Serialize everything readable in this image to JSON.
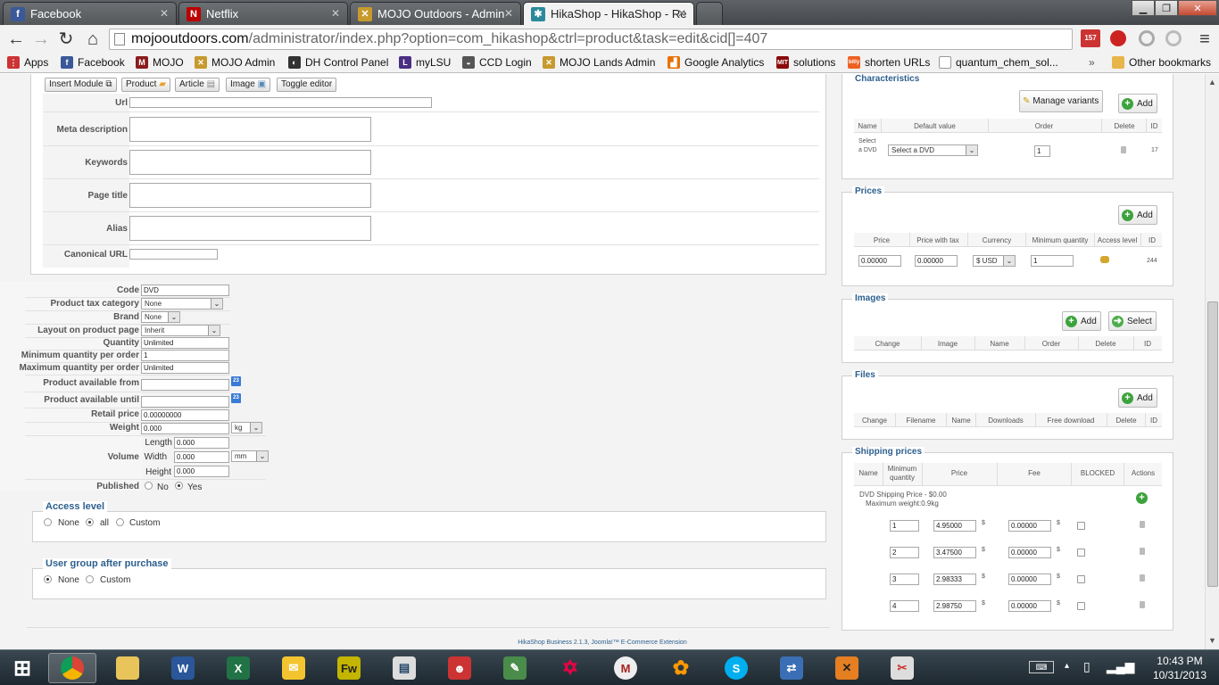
{
  "tabs": [
    {
      "title": "Facebook",
      "icon": "facebook-icon",
      "active": false
    },
    {
      "title": "Netflix",
      "icon": "netflix-icon",
      "active": false
    },
    {
      "title": "MOJO Outdoors - Admin",
      "icon": "mojo-icon",
      "active": false
    },
    {
      "title": "HikaShop - HikaShop - Re",
      "icon": "hikashop-icon",
      "active": true
    }
  ],
  "address": {
    "host": "mojooutdoors.com",
    "path": "/administrator/index.php?option=com_hikashop&ctrl=product&task=edit&cid[]=407"
  },
  "mail_badge": "157",
  "bookmarks": [
    "Apps",
    "Facebook",
    "MOJO",
    "MOJO Admin",
    "DH Control Panel",
    "myLSU",
    "CCD Login",
    "MOJO Lands Admin",
    "Google Analytics",
    "solutions",
    "shorten URLs",
    "quantum_chem_sol...",
    "Other bookmarks"
  ],
  "editor_buttons": [
    "Insert Module",
    "Product",
    "Article",
    "Image",
    "Toggle editor"
  ],
  "meta": {
    "url": "Url",
    "meta_description": "Meta description",
    "keywords": "Keywords",
    "page_title": "Page title",
    "alias": "Alias",
    "canonical_url": "Canonical URL"
  },
  "product": {
    "code_label": "Code",
    "code_value": "DVD",
    "tax_label": "Product tax category",
    "tax_value": "None",
    "brand_label": "Brand",
    "brand_value": "None",
    "layout_label": "Layout on product page",
    "layout_value": "Inherit",
    "quantity_label": "Quantity",
    "quantity_value": "Unlimited",
    "min_qty_label": "Minimum quantity per order",
    "min_qty_value": "1",
    "max_qty_label": "Maximum quantity per order",
    "max_qty_value": "Unlimited",
    "avail_from_label": "Product available from",
    "avail_until_label": "Product available until",
    "retail_label": "Retail price",
    "retail_value": "0.00000000",
    "weight_label": "Weight",
    "weight_value": "0.000",
    "weight_unit": "kg",
    "volume_label": "Volume",
    "length_label": "Length",
    "length_value": "0.000",
    "width_label": "Width",
    "width_value": "0.000",
    "dim_unit": "mm",
    "height_label": "Height",
    "height_value": "0.000",
    "published_label": "Published",
    "published_no": "No",
    "published_yes": "Yes",
    "calendar_glyph": "23"
  },
  "access_level": {
    "title": "Access level",
    "options": [
      "None",
      "all",
      "Custom"
    ],
    "selected": "all"
  },
  "user_group": {
    "title": "User group after purchase",
    "options": [
      "None",
      "Custom"
    ],
    "selected": "None"
  },
  "footer": "HikaShop Business 2.1.3, Joomla!™ E-Commerce Extension",
  "characteristics": {
    "title": "Characteristics",
    "manage_label": "Manage variants",
    "add_label": "Add",
    "headers": [
      "Name",
      "Default value",
      "Order",
      "Delete",
      "ID"
    ],
    "row": {
      "name": "Select a DVD",
      "default": "Select a DVD",
      "order": "1",
      "id": "17"
    }
  },
  "prices": {
    "title": "Prices",
    "add_label": "Add",
    "headers": [
      "Price",
      "Price with tax",
      "Currency",
      "Minimum quantity",
      "Access level",
      "ID"
    ],
    "row": {
      "price": "0.00000",
      "price_tax": "0.00000",
      "currency": "$ USD",
      "min_qty": "1",
      "id": "244"
    }
  },
  "images": {
    "title": "Images",
    "add_label": "Add",
    "select_label": "Select",
    "headers": [
      "Change",
      "Image",
      "Name",
      "Order",
      "Delete",
      "ID"
    ]
  },
  "files": {
    "title": "Files",
    "add_label": "Add",
    "headers": [
      "Change",
      "Filename",
      "Name",
      "Downloads",
      "Free download",
      "Delete",
      "ID"
    ]
  },
  "shipping": {
    "title": "Shipping prices",
    "headers": [
      "Name",
      "Minimum quantity",
      "Price",
      "Fee",
      "BLOCKED",
      "Actions"
    ],
    "method_name": "DVD Shipping Price - $0.00",
    "method_sub": "Maximum weight:0.9kg",
    "currency_symbol": "$",
    "rows": [
      {
        "qty": "1",
        "price": "4.95000",
        "fee": "0.00000"
      },
      {
        "qty": "2",
        "price": "3.47500",
        "fee": "0.00000"
      },
      {
        "qty": "3",
        "price": "2.98333",
        "fee": "0.00000"
      },
      {
        "qty": "4",
        "price": "2.98750",
        "fee": "0.00000"
      }
    ]
  },
  "taskbar": {
    "time": "10:43 PM",
    "date": "10/31/2013"
  }
}
